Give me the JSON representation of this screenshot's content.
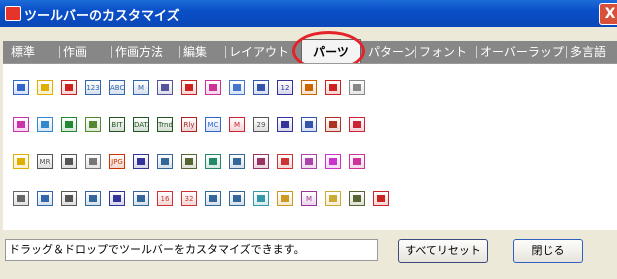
{
  "window": {
    "title": "ツールバーのカスタマイズ",
    "close_glyph": "X"
  },
  "tabs": [
    {
      "label": "標準",
      "active": false
    },
    {
      "label": "作画",
      "active": false
    },
    {
      "label": "作画方法",
      "active": false
    },
    {
      "label": "編集",
      "active": false
    },
    {
      "label": "レイアウト",
      "active": false
    },
    {
      "label": "パーツ",
      "active": true
    },
    {
      "label": "パターン",
      "active": false
    },
    {
      "label": "フォント",
      "active": false
    },
    {
      "label": "オーバーラップ",
      "active": false
    },
    {
      "label": "多言語",
      "active": false
    }
  ],
  "highlight_color": "#e3222a",
  "icon_rows": [
    [
      {
        "name": "screen-window-icon",
        "color": "#3366cc",
        "text": ""
      },
      {
        "name": "alarm-icon",
        "color": "#e0b000",
        "text": ""
      },
      {
        "name": "alarm-history-icon",
        "color": "#cc2222",
        "text": ""
      },
      {
        "name": "numeric-display-icon",
        "color": "#3366aa",
        "text": "123"
      },
      {
        "name": "ascii-display-icon",
        "color": "#3366aa",
        "text": "ABC"
      },
      {
        "name": "message-display-icon",
        "color": "#3366aa",
        "text": "M"
      },
      {
        "name": "table-data-icon",
        "color": "#555599",
        "text": ""
      },
      {
        "name": "lamp-icon",
        "color": "#cc2222",
        "text": ""
      },
      {
        "name": "switch-hand-icon",
        "color": "#cc3399",
        "text": ""
      },
      {
        "name": "comment-icon",
        "color": "#4477cc",
        "text": ""
      },
      {
        "name": "calculator-icon",
        "color": "#3355aa",
        "text": ""
      },
      {
        "name": "data-display-icon",
        "color": "#333399",
        "text": "12"
      },
      {
        "name": "graph-icon",
        "color": "#cc6600",
        "text": ""
      },
      {
        "name": "pie-chart-icon",
        "color": "#cc2222",
        "text": ""
      },
      {
        "name": "meter-icon",
        "color": "#888888",
        "text": ""
      }
    ],
    [
      {
        "name": "edit-icon",
        "color": "#cc33aa",
        "text": ""
      },
      {
        "name": "image-icon",
        "color": "#3388cc",
        "text": ""
      },
      {
        "name": "animation-icon",
        "color": "#228833",
        "text": ""
      },
      {
        "name": "sample-icon",
        "color": "#558833",
        "text": ""
      },
      {
        "name": "bit-icon",
        "color": "#225522",
        "text": "BIT"
      },
      {
        "name": "data-icon",
        "color": "#225522",
        "text": "DATA"
      },
      {
        "name": "trend-icon",
        "color": "#225522",
        "text": "Trnd"
      },
      {
        "name": "relay-icon",
        "color": "#aa2222",
        "text": "Rly"
      },
      {
        "name": "memory-card-icon",
        "color": "#3366cc",
        "text": "MC"
      },
      {
        "name": "macro-icon",
        "color": "#cc2233",
        "text": "M"
      },
      {
        "name": "calendar-icon",
        "color": "#555555",
        "text": "29"
      },
      {
        "name": "window-frame-icon",
        "color": "#333399",
        "text": ""
      },
      {
        "name": "disk-icon",
        "color": "#3355aa",
        "text": ""
      },
      {
        "name": "timer-icon",
        "color": "#aa3322",
        "text": ""
      },
      {
        "name": "flask-icon",
        "color": "#cc2233",
        "text": ""
      }
    ],
    [
      {
        "name": "bell-icon",
        "color": "#e0b000",
        "text": ""
      },
      {
        "name": "morph-icon",
        "color": "#555555",
        "text": "MR"
      },
      {
        "name": "sound-icon",
        "color": "#555555",
        "text": ""
      },
      {
        "name": "character-icon",
        "color": "#777777",
        "text": ""
      },
      {
        "name": "jpeg-icon",
        "color": "#cc3300",
        "text": "JPG"
      },
      {
        "name": "camera-icon",
        "color": "#333399",
        "text": ""
      },
      {
        "name": "network-icon",
        "color": "#336699",
        "text": ""
      },
      {
        "name": "script-icon",
        "color": "#556633",
        "text": ""
      },
      {
        "name": "picture-icon",
        "color": "#228866",
        "text": ""
      },
      {
        "name": "video-icon",
        "color": "#336699",
        "text": ""
      },
      {
        "name": "capture-icon",
        "color": "#993366",
        "text": ""
      },
      {
        "name": "record-icon",
        "color": "#cc3333",
        "text": ""
      },
      {
        "name": "monitor-icon",
        "color": "#aa44aa",
        "text": ""
      },
      {
        "name": "edit-screen-icon",
        "color": "#cc33cc",
        "text": ""
      },
      {
        "name": "users-icon",
        "color": "#cc3399",
        "text": ""
      }
    ],
    [
      {
        "name": "keypad-icon",
        "color": "#666666",
        "text": ""
      },
      {
        "name": "slider-icon",
        "color": "#3366aa",
        "text": ""
      },
      {
        "name": "radio-button-icon",
        "color": "#555555",
        "text": ""
      },
      {
        "name": "list-box-icon",
        "color": "#336699",
        "text": ""
      },
      {
        "name": "panel-icon",
        "color": "#333399",
        "text": ""
      },
      {
        "name": "list-view-icon",
        "color": "#336699",
        "text": ""
      },
      {
        "name": "recipe-icon",
        "color": "#cc3333",
        "text": "16"
      },
      {
        "name": "recipe-32-icon",
        "color": "#cc3333",
        "text": "32"
      },
      {
        "name": "draw-edit-icon",
        "color": "#336699",
        "text": ""
      },
      {
        "name": "view-icon",
        "color": "#336699",
        "text": ""
      },
      {
        "name": "block-icon",
        "color": "#3399aa",
        "text": ""
      },
      {
        "name": "folder-write-icon",
        "color": "#cc9922",
        "text": ""
      },
      {
        "name": "macro-run-icon",
        "color": "#993399",
        "text": "M"
      },
      {
        "name": "folder-icon",
        "color": "#ccaa33",
        "text": ""
      },
      {
        "name": "multi-file-icon",
        "color": "#556633",
        "text": ""
      },
      {
        "name": "pump-icon",
        "color": "#cc2222",
        "text": ""
      }
    ]
  ],
  "status_text": "ドラッグ＆ドロップでツールバーをカスタマイズできます。",
  "buttons": {
    "reset_label": "すべてリセット",
    "close_label": "閉じる"
  }
}
